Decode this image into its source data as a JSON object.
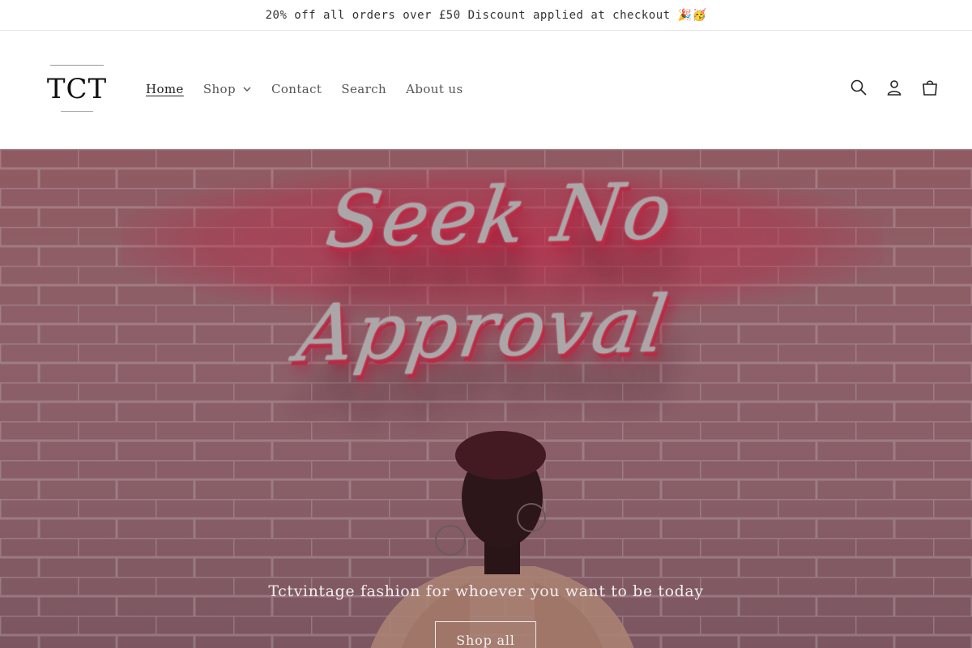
{
  "announcement": {
    "text": "20% off all orders over £50 Discount applied at checkout 🎉🥳"
  },
  "header": {
    "logo_text": "TCT",
    "nav": {
      "home": "Home",
      "shop": "Shop",
      "contact": "Contact",
      "search": "Search",
      "about": "About us"
    },
    "icons": [
      "search-icon",
      "account-icon",
      "cart-icon"
    ]
  },
  "hero": {
    "neon_sign": "Seek No Approval",
    "tagline": "Tctvintage fashion for whoever you want to be today",
    "button_label": "Shop all"
  },
  "colors": {
    "neon_red": "#d8304e",
    "hero_tint": "#a86a72"
  }
}
